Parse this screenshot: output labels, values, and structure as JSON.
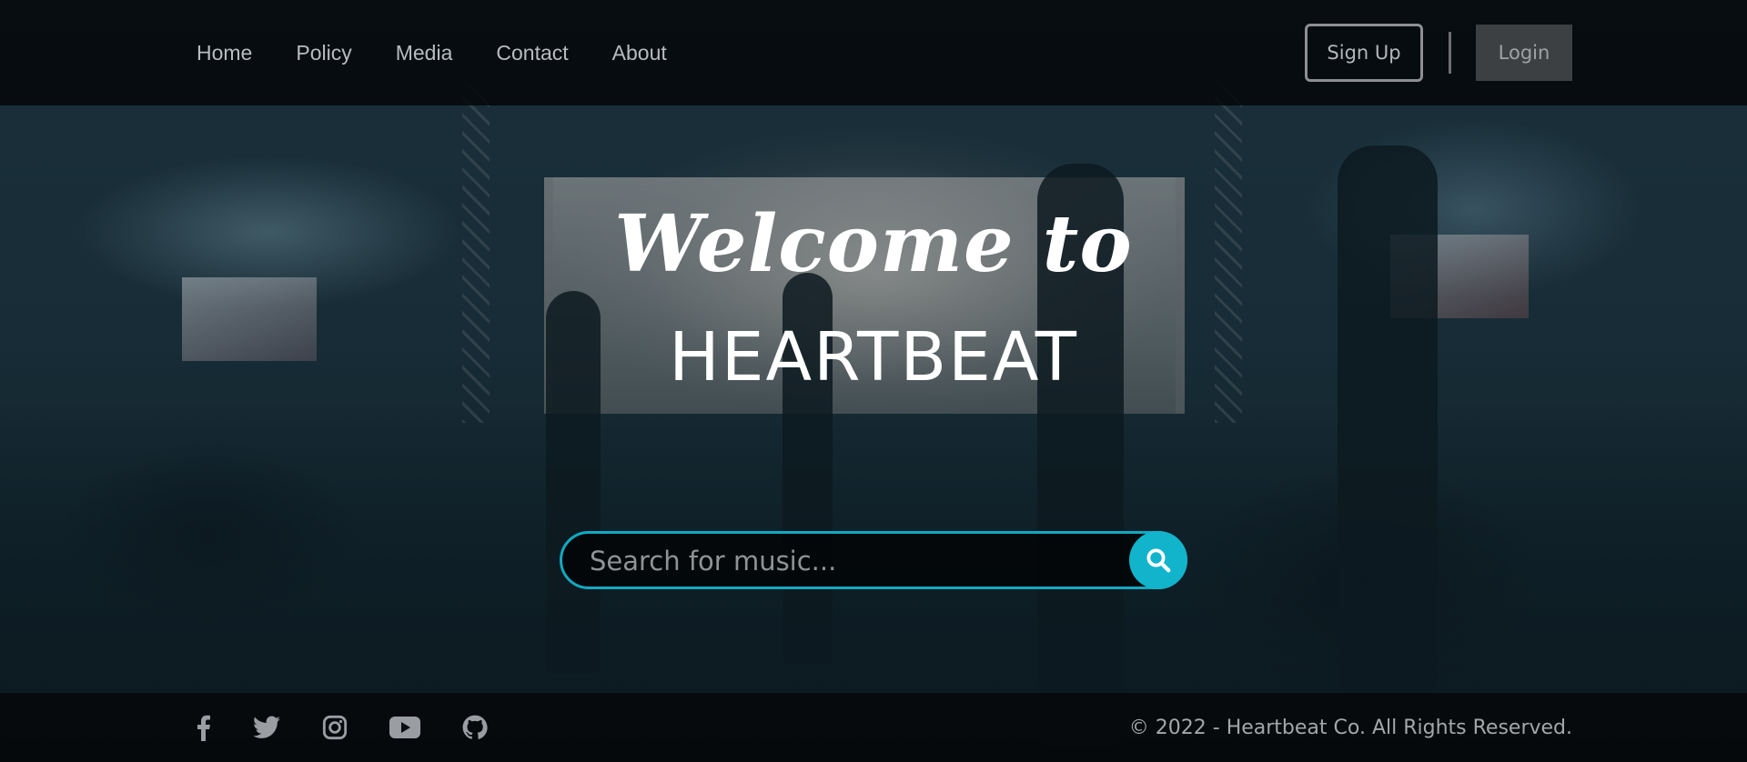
{
  "nav": {
    "items": [
      {
        "label": "Home"
      },
      {
        "label": "Policy"
      },
      {
        "label": "Media"
      },
      {
        "label": "Contact"
      },
      {
        "label": "About"
      }
    ]
  },
  "auth": {
    "signup_label": "Sign Up",
    "login_label": "Login"
  },
  "hero": {
    "welcome": "Welcome to",
    "brand": "HEARTBEAT"
  },
  "search": {
    "placeholder": "Search for music...",
    "value": "",
    "icon": "search-icon"
  },
  "footer": {
    "social_icons": [
      "facebook-icon",
      "twitter-icon",
      "instagram-icon",
      "youtube-icon",
      "github-icon"
    ],
    "copyright": "© 2022 - Heartbeat Co. All Rights Reserved."
  },
  "colors": {
    "accent": "#12b4cc",
    "header_bg": "#05080a",
    "text_muted": "#b9bcbf"
  }
}
